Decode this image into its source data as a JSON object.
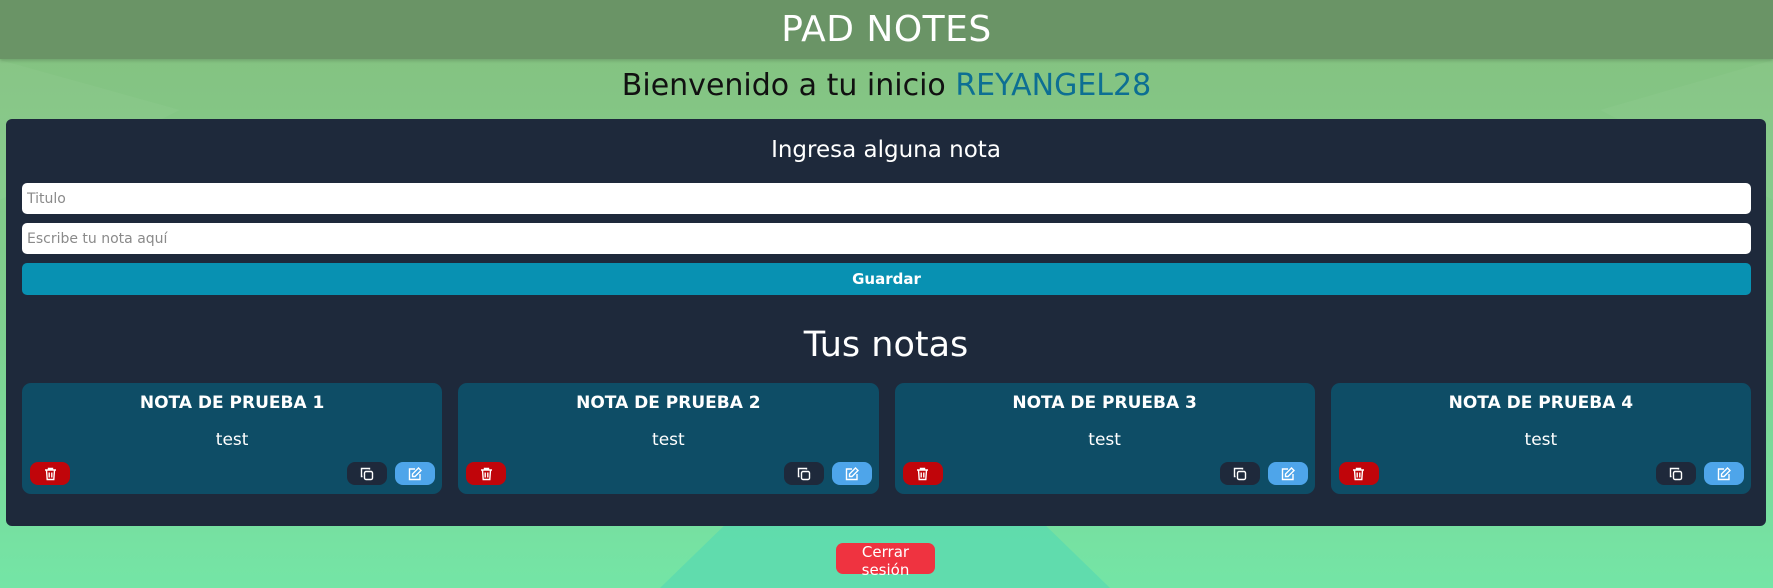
{
  "header": {
    "title": "PAD NOTES"
  },
  "welcome": {
    "text": "Bienvenido a tu inicio",
    "username": "REYANGEL28"
  },
  "form": {
    "heading": "Ingresa alguna nota",
    "title_placeholder": "Titulo",
    "title_value": "",
    "note_placeholder": "Escribe tu nota aquí",
    "note_value": "",
    "save_label": "Guardar"
  },
  "notes_section": {
    "heading": "Tus notas",
    "notes": [
      {
        "title": "NOTA DE PRUEBA 1",
        "body": "test"
      },
      {
        "title": "NOTA DE PRUEBA 2",
        "body": "test"
      },
      {
        "title": "NOTA DE PRUEBA 3",
        "body": "test"
      },
      {
        "title": "NOTA DE PRUEBA 4",
        "body": "test"
      }
    ],
    "actions": {
      "delete_icon": "trash-icon",
      "copy_icon": "copy-icon",
      "edit_icon": "edit-icon"
    }
  },
  "logout": {
    "label": "Cerrar sesión"
  },
  "colors": {
    "header": "#6a9466",
    "panel": "#1e293b",
    "note_card": "#0e4d66",
    "save_button": "#0891b2",
    "delete_button": "#c0050a",
    "edit_button": "#4ea5ea",
    "logout_button": "#ef3340",
    "username": "#0d6f93"
  }
}
